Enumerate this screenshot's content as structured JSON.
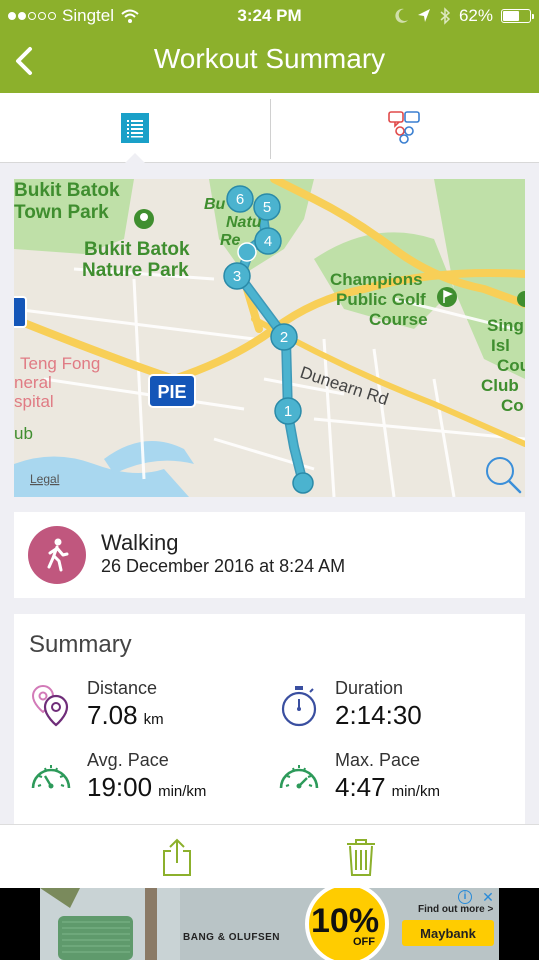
{
  "status": {
    "carrier": "Singtel",
    "time": "3:24 PM",
    "battery": "62%",
    "battery_fraction": 0.62
  },
  "nav": {
    "title": "Workout Summary",
    "back_icon": "chevron-left-icon"
  },
  "tabs": [
    {
      "name": "list-tab",
      "icon": "list-icon",
      "selected": true
    },
    {
      "name": "chat-tab",
      "icon": "chat-bubbles-icon",
      "selected": false
    }
  ],
  "map": {
    "labels": {
      "park1": "Bukit Batok",
      "park1b": "Town Park",
      "park2": "Bukit Batok",
      "park2b": "Nature Park",
      "reserve1": "Bu   ah",
      "reserve2": "Natu",
      "reserve3": "Re",
      "golf1": "Champions",
      "golf2": "Public Golf",
      "golf3": "Course",
      "road": "Dunearn Rd",
      "hospital1": "Teng Fong",
      "hospital2": "neral",
      "hospital3": "spital",
      "club1": "Sing",
      "club2": "Isl",
      "club3": "Cou",
      "club4": "Club",
      "club5": "Co",
      "pie": "PIE",
      "ub": "ub",
      "legal": "Legal"
    },
    "markers": [
      "1",
      "2",
      "3",
      "4",
      "5",
      "6"
    ],
    "search_icon": "magnifier-icon"
  },
  "activity": {
    "name": "Walking",
    "date": "26 December 2016 at 8:24 AM",
    "icon": "walking-person-icon",
    "color": "#c0577e"
  },
  "summary": {
    "title": "Summary",
    "distance": {
      "label": "Distance",
      "value": "7.08",
      "unit": "km"
    },
    "duration": {
      "label": "Duration",
      "value": "2:14:30"
    },
    "avg_pace": {
      "label": "Avg. Pace",
      "value": "19:00",
      "unit": "min/km"
    },
    "max_pace": {
      "label": "Max. Pace",
      "value": "4:47",
      "unit": "min/km"
    }
  },
  "toolbar": {
    "share_icon": "share-icon",
    "delete_icon": "trash-icon"
  },
  "ad": {
    "brand": "BANG & OLUFSEN",
    "percent": "10%",
    "off": "OFF",
    "cta": "Find out more >",
    "bank": "Maybank"
  },
  "colors": {
    "accent": "#8cb02c",
    "route": "#4bb3cf",
    "activity": "#c0577e"
  }
}
